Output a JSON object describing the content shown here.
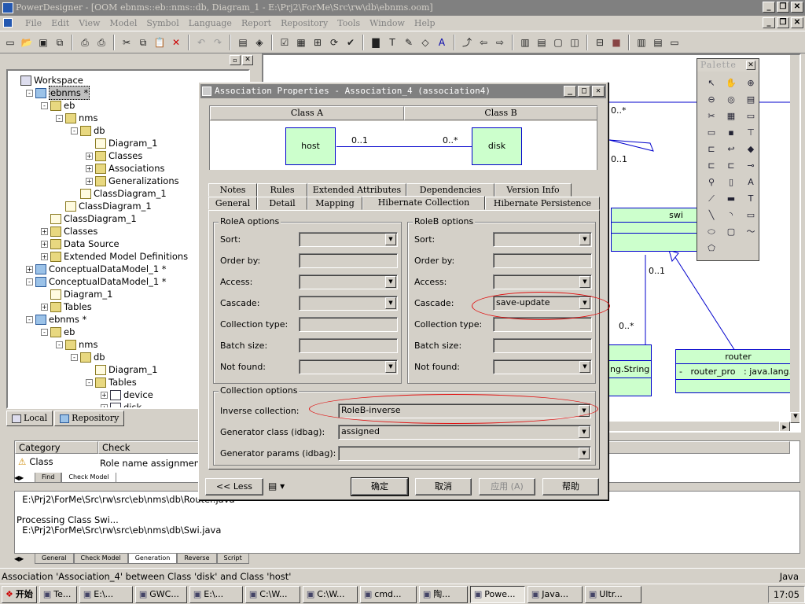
{
  "app": {
    "title": "PowerDesigner - [OOM ebnms::eb::nms::db, Diagram_1 - E:\\Prj2\\ForMe\\Src\\rw\\db\\ebnms.oom]",
    "menu": [
      "File",
      "Edit",
      "View",
      "Model",
      "Symbol",
      "Language",
      "Report",
      "Repository",
      "Tools",
      "Window",
      "Help"
    ]
  },
  "browser": {
    "items": [
      {
        "label": "Workspace",
        "depth": 0,
        "icon": "workspace-icon",
        "exp": ""
      },
      {
        "label": "ebnms *",
        "depth": 1,
        "icon": "model-icon",
        "exp": "-",
        "selected": true
      },
      {
        "label": "eb",
        "depth": 2,
        "icon": "folder-icon",
        "exp": "-"
      },
      {
        "label": "nms",
        "depth": 3,
        "icon": "folder-icon",
        "exp": "-"
      },
      {
        "label": "db",
        "depth": 4,
        "icon": "folder-icon",
        "exp": "-"
      },
      {
        "label": "Diagram_1",
        "depth": 5,
        "icon": "diagram-icon",
        "exp": ""
      },
      {
        "label": "Classes",
        "depth": 5,
        "icon": "folder-icon",
        "exp": "+"
      },
      {
        "label": "Associations",
        "depth": 5,
        "icon": "folder-icon",
        "exp": "+"
      },
      {
        "label": "Generalizations",
        "depth": 5,
        "icon": "folder-icon",
        "exp": "+"
      },
      {
        "label": "ClassDiagram_1",
        "depth": 4,
        "icon": "diagram-icon",
        "exp": ""
      },
      {
        "label": "ClassDiagram_1",
        "depth": 3,
        "icon": "diagram-icon",
        "exp": ""
      },
      {
        "label": "ClassDiagram_1",
        "depth": 2,
        "icon": "diagram-icon",
        "exp": ""
      },
      {
        "label": "Classes",
        "depth": 2,
        "icon": "folder-icon",
        "exp": "+"
      },
      {
        "label": "Data Source",
        "depth": 2,
        "icon": "folder-icon",
        "exp": "+"
      },
      {
        "label": "Extended Model Definitions",
        "depth": 2,
        "icon": "folder-icon",
        "exp": "+"
      },
      {
        "label": "ConceptualDataModel_1 *",
        "depth": 1,
        "icon": "model-icon",
        "exp": "+"
      },
      {
        "label": "ConceptualDataModel_1 *",
        "depth": 1,
        "icon": "model-icon",
        "exp": "-"
      },
      {
        "label": "Diagram_1",
        "depth": 2,
        "icon": "diagram-icon",
        "exp": ""
      },
      {
        "label": "Tables",
        "depth": 2,
        "icon": "folder-icon",
        "exp": "+"
      },
      {
        "label": "ebnms *",
        "depth": 1,
        "icon": "model-icon",
        "exp": "-"
      },
      {
        "label": "eb",
        "depth": 2,
        "icon": "folder-icon",
        "exp": "-"
      },
      {
        "label": "nms",
        "depth": 3,
        "icon": "folder-icon",
        "exp": "-"
      },
      {
        "label": "db",
        "depth": 4,
        "icon": "folder-icon",
        "exp": "-"
      },
      {
        "label": "Diagram_1",
        "depth": 5,
        "icon": "diagram-icon",
        "exp": ""
      },
      {
        "label": "Tables",
        "depth": 5,
        "icon": "folder-icon",
        "exp": "-"
      },
      {
        "label": "device",
        "depth": 6,
        "icon": "table-icon",
        "exp": "+"
      },
      {
        "label": "disk",
        "depth": 6,
        "icon": "table-icon",
        "exp": "+"
      }
    ],
    "tabs": [
      "Local",
      "Repository"
    ]
  },
  "diagram": {
    "mult": {
      "a": "0..*",
      "b": "0..1",
      "c": "0..1",
      "d": "0..*"
    },
    "swi": {
      "name": "swi"
    },
    "router": {
      "name": "router",
      "attr": "-   router_pro   : java.lang.String"
    },
    "partial_attr": "ng.String"
  },
  "palette": {
    "title": "Palette"
  },
  "check": {
    "headers": [
      "Category",
      "Check"
    ],
    "rows": [
      {
        "category": "Class",
        "check": "Role name assignment"
      }
    ],
    "tabs": [
      "Find",
      "Check Model"
    ]
  },
  "output": {
    "lines": [
      "  E:\\Prj2\\ForMe\\Src\\rw\\src\\eb\\nms\\db\\Router.java",
      "",
      "Processing Class Swi...",
      "  E:\\Prj2\\ForMe\\Src\\rw\\src\\eb\\nms\\db\\Swi.java"
    ],
    "tabs": [
      "General",
      "Check Model",
      "Generation",
      "Reverse",
      "Script"
    ]
  },
  "status": {
    "text": "Association 'Association_4' between Class 'disk' and Class 'host'",
    "lang": "Java"
  },
  "taskbar": {
    "start": "开始",
    "tasks": [
      "Te...",
      "E:\\...",
      "GWC...",
      "E:\\...",
      "C:\\W...",
      "C:\\W...",
      "cmd...",
      "陶...",
      "Powe...",
      "Java...",
      "Ultr..."
    ],
    "time": "17:05"
  },
  "dialog": {
    "title": "Association Properties - Association_4 (association4)",
    "class_a_header": "Class A",
    "class_b_header": "Class B",
    "class_a": "host",
    "class_b": "disk",
    "mult_a": "0..1",
    "mult_b": "0..*",
    "tabs_back": [
      "Notes",
      "Rules",
      "Extended Attributes",
      "Dependencies",
      "Version Info"
    ],
    "tabs_front": [
      "General",
      "Detail",
      "Mapping",
      "Hibernate Collection",
      "Hibernate Persistence"
    ],
    "active_tab": "Hibernate Collection",
    "rolea": {
      "label": "RoleA options",
      "fields": [
        {
          "label": "Sort:",
          "value": "",
          "type": "dd"
        },
        {
          "label": "Order by:",
          "value": "",
          "type": "text"
        },
        {
          "label": "Access:",
          "value": "",
          "type": "dd"
        },
        {
          "label": "Cascade:",
          "value": "",
          "type": "dd"
        },
        {
          "label": "Collection type:",
          "value": "",
          "type": "text"
        },
        {
          "label": "Batch size:",
          "value": "",
          "type": "text"
        },
        {
          "label": "Not found:",
          "value": "",
          "type": "dd"
        }
      ]
    },
    "roleb": {
      "label": "RoleB options",
      "fields": [
        {
          "label": "Sort:",
          "value": "",
          "type": "dd"
        },
        {
          "label": "Order by:",
          "value": "",
          "type": "text"
        },
        {
          "label": "Access:",
          "value": "",
          "type": "dd"
        },
        {
          "label": "Cascade:",
          "value": "save-update",
          "type": "dd"
        },
        {
          "label": "Collection type:",
          "value": "",
          "type": "text"
        },
        {
          "label": "Batch size:",
          "value": "",
          "type": "text"
        },
        {
          "label": "Not found:",
          "value": "",
          "type": "dd"
        }
      ]
    },
    "collection": {
      "label": "Collection options",
      "inverse_label": "Inverse collection:",
      "inverse_value": "RoleB-inverse",
      "generator_label": "Generator class (idbag):",
      "generator_value": "assigned",
      "params_label": "Generator params (idbag):",
      "params_value": ""
    },
    "buttons": {
      "less": "<< Less",
      "ok": "确定",
      "cancel": "取消",
      "apply": "应用 (A)",
      "help": "帮助"
    }
  },
  "colors": {
    "class_fill": "#ccffcc",
    "class_border": "#0000cc",
    "highlight": "#e01010"
  }
}
